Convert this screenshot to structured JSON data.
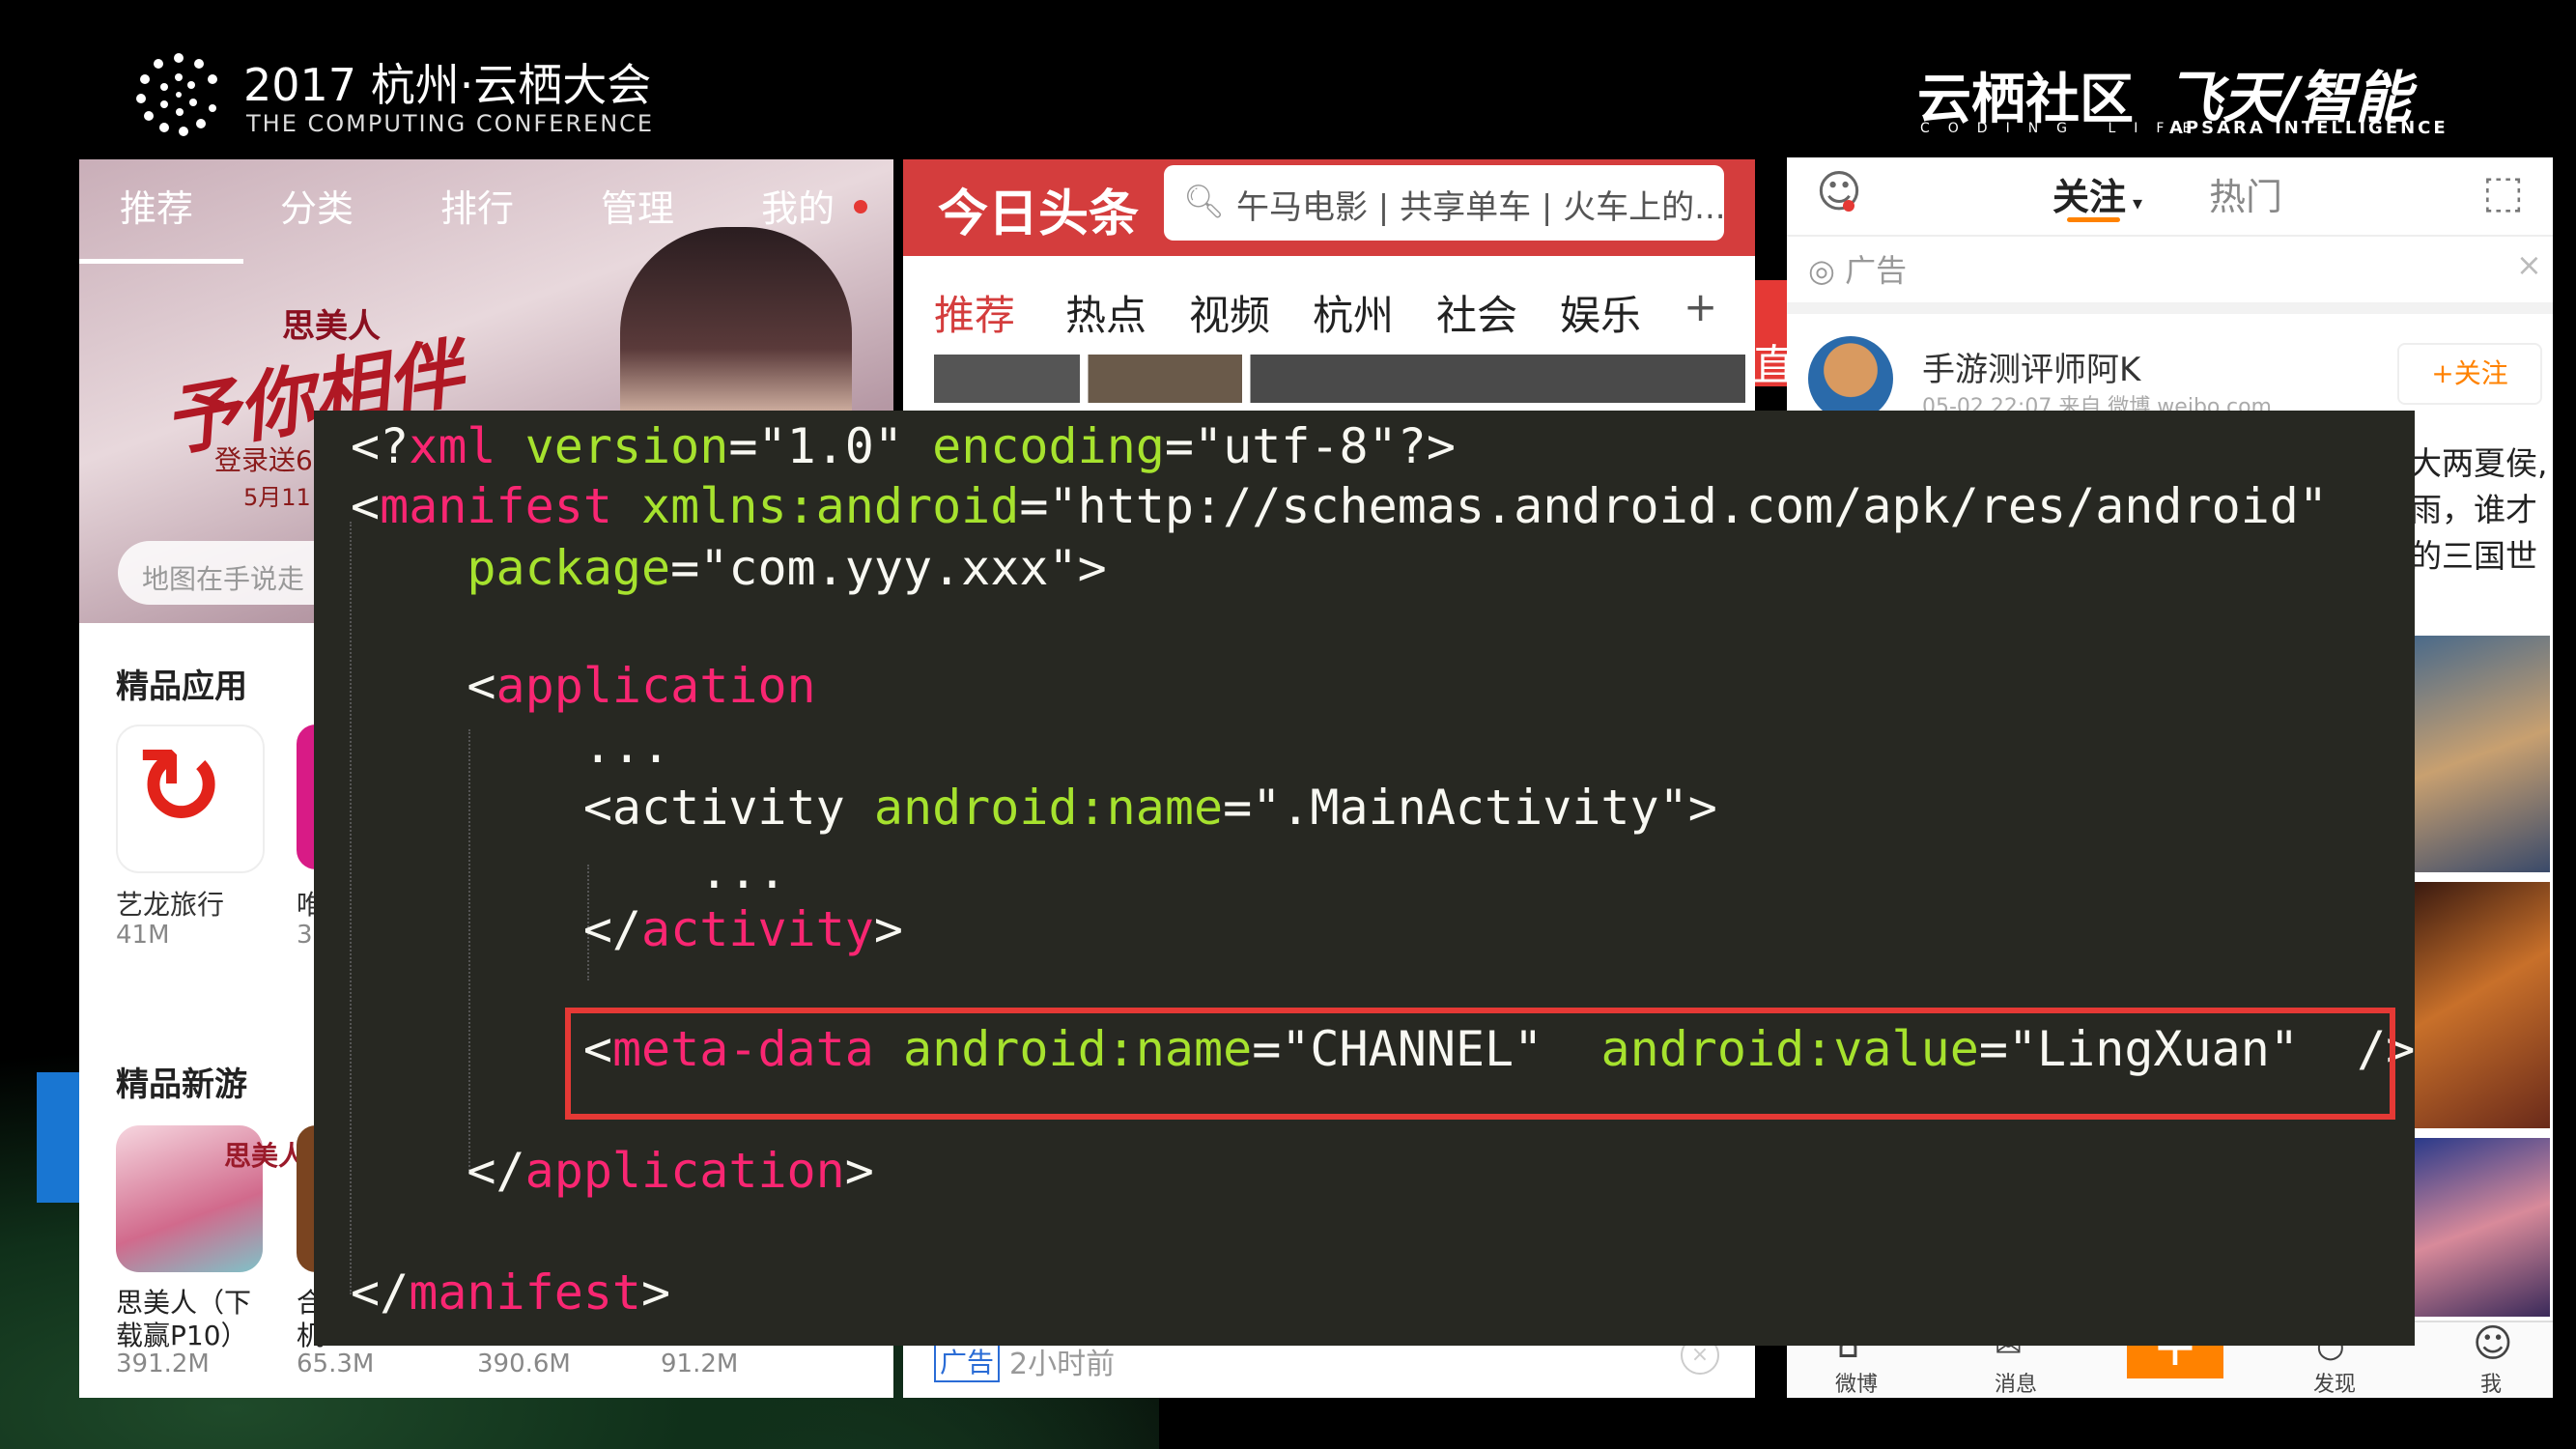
{
  "header": {
    "conference_title": "2017 杭州·云栖大会",
    "conference_subtitle": "THE COMPUTING CONFERENCE",
    "brand_left": "云栖社区",
    "brand_left_sub": "CODING LIFE",
    "brand_right": "飞天/智能",
    "brand_right_sub": "APSARA INTELLIGENCE"
  },
  "app_store": {
    "tabs": [
      "推荐",
      "分类",
      "排行",
      "管理",
      "我的"
    ],
    "banner_game_logo": "思美人",
    "banner_title": "予你相伴",
    "banner_login": "登录送6",
    "banner_date": "5月11日",
    "search_placeholder": "地图在手说走",
    "section_apps": "精品应用",
    "apps": [
      {
        "name": "艺龙旅行",
        "size": "41M"
      },
      {
        "name": "唯",
        "size": "3"
      }
    ],
    "section_games": "精品新游",
    "games": [
      {
        "name_line1": "思美人（下",
        "name_line2": "载赢P10）",
        "size": "391.2M"
      },
      {
        "name_line1": "合",
        "name_line2": "机",
        "size": "65.3M"
      },
      {
        "size": "390.6M"
      },
      {
        "size": "91.2M"
      }
    ]
  },
  "toutiao": {
    "logo": "今日头条",
    "search_text": "午马电影 | 共享单车 | 火车上的...",
    "nav": [
      "推荐",
      "热点",
      "视频",
      "杭州",
      "社会",
      "娱乐",
      "+"
    ],
    "ad_label": "广告",
    "ad_time": "2小时前",
    "ad_close": "×",
    "side_text": "直"
  },
  "weibo": {
    "tab_follow": "关注",
    "tab_hot": "热门",
    "ad_label": "广告",
    "ad_close": "×",
    "user_name": "手游测评师阿K",
    "post_meta": "05-02 22:07  来自 微博 weibo.com",
    "follow_button": "+关注",
    "post_text": [
      "大两夏侯,",
      "雨，谁才",
      "的三国世"
    ],
    "bottom_tabs": [
      "微博",
      "消息",
      "+",
      "发现",
      "我"
    ]
  },
  "code": {
    "lines": [
      {
        "parts": [
          [
            "pun",
            "<?"
          ],
          [
            "tag",
            "xml"
          ],
          [
            "pun",
            " "
          ],
          [
            "attr",
            "version"
          ],
          [
            "pun",
            "="
          ],
          [
            "str",
            "\"1.0\""
          ],
          [
            "pun",
            " "
          ],
          [
            "attr",
            "encoding"
          ],
          [
            "pun",
            "="
          ],
          [
            "str",
            "\"utf-8\""
          ],
          [
            "pun",
            "?>"
          ]
        ]
      },
      {
        "parts": [
          [
            "pun",
            "<"
          ],
          [
            "tag",
            "manifest"
          ],
          [
            "pun",
            " "
          ],
          [
            "attr",
            "xmlns:android"
          ],
          [
            "pun",
            "="
          ],
          [
            "str",
            "\"http://schemas.android.com/apk/res/android\""
          ]
        ]
      },
      {
        "parts": [
          [
            "pun",
            "    "
          ],
          [
            "attr",
            "package"
          ],
          [
            "pun",
            "="
          ],
          [
            "str",
            "\"com.yyy.xxx\""
          ],
          [
            "pun",
            ">"
          ]
        ]
      },
      {
        "parts": [
          [
            "pun",
            "    <"
          ],
          [
            "tag",
            "application"
          ]
        ]
      },
      {
        "parts": [
          [
            "pun",
            "        ..."
          ]
        ]
      },
      {
        "parts": [
          [
            "pun",
            "        <activity "
          ],
          [
            "attr",
            "android:name"
          ],
          [
            "pun",
            "="
          ],
          [
            "str",
            "\".MainActivity\""
          ],
          [
            "pun",
            ">"
          ]
        ]
      },
      {
        "parts": [
          [
            "pun",
            "            ..."
          ]
        ]
      },
      {
        "parts": [
          [
            "pun",
            "        </"
          ],
          [
            "tag",
            "activity"
          ],
          [
            "pun",
            ">"
          ]
        ]
      },
      {
        "parts": [
          [
            "pun",
            "        <"
          ],
          [
            "tag",
            "meta-data"
          ],
          [
            "pun",
            " "
          ],
          [
            "attr",
            "android:name"
          ],
          [
            "pun",
            "="
          ],
          [
            "str",
            "\"CHANNEL\""
          ],
          [
            "pun",
            "  "
          ],
          [
            "attr",
            "android:value"
          ],
          [
            "pun",
            "="
          ],
          [
            "str",
            "\"LingXuan\""
          ],
          [
            "pun",
            "  />"
          ]
        ]
      },
      {
        "parts": [
          [
            "pun",
            "    </"
          ],
          [
            "tag",
            "application"
          ],
          [
            "pun",
            ">"
          ]
        ]
      },
      {
        "parts": [
          [
            "pun",
            "</"
          ],
          [
            "tag",
            "manifest"
          ],
          [
            "pun",
            ">"
          ]
        ]
      }
    ]
  },
  "colors": {
    "code_bg": "#272822",
    "tag": "#f92672",
    "attr": "#a6e22e",
    "highlight_border": "#e53935",
    "toutiao_red": "#d43d3d",
    "weibo_orange": "#ff8200"
  }
}
